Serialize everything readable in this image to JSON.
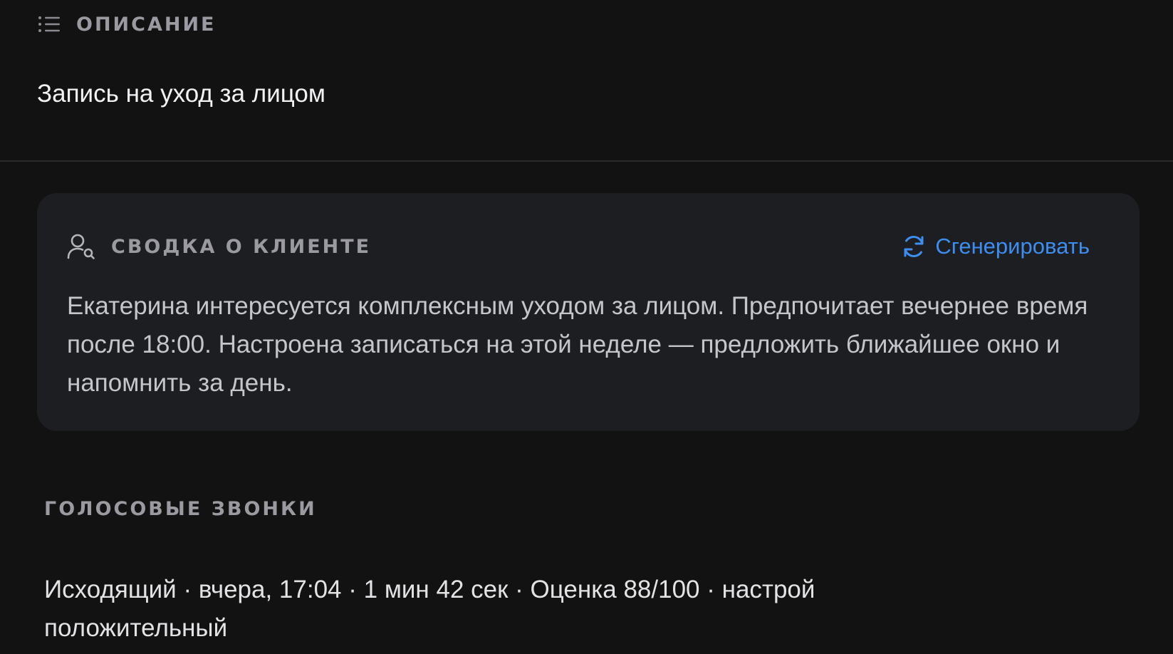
{
  "description": {
    "title": "ОПИСАНИЕ",
    "text": "Запись на уход за лицом"
  },
  "client_summary": {
    "title": "СВОДКА О КЛИЕНТЕ",
    "generate_label": "Сгенерировать",
    "text": "Екатерина интересуется комплексным уходом за лицом. Предпочитает вечернее время после 18:00. Настроена записаться на этой неделе — предложить ближайшее окно и напомнить за день."
  },
  "voice_calls": {
    "title": "ГОЛОСОВЫЕ ЗВОНКИ",
    "items": [
      {
        "text": "Исходящий · вчера, 17:04 · 1 мин 42 сек · Оценка 88/100 · настрой положительный"
      }
    ]
  },
  "colors": {
    "background": "#121213",
    "card": "#1d1e22",
    "accent": "#3d8ef0",
    "muted": "#9a9aa0"
  },
  "icons": {
    "description": "list-icon",
    "summary": "user-search-icon",
    "generate": "refresh-icon"
  }
}
